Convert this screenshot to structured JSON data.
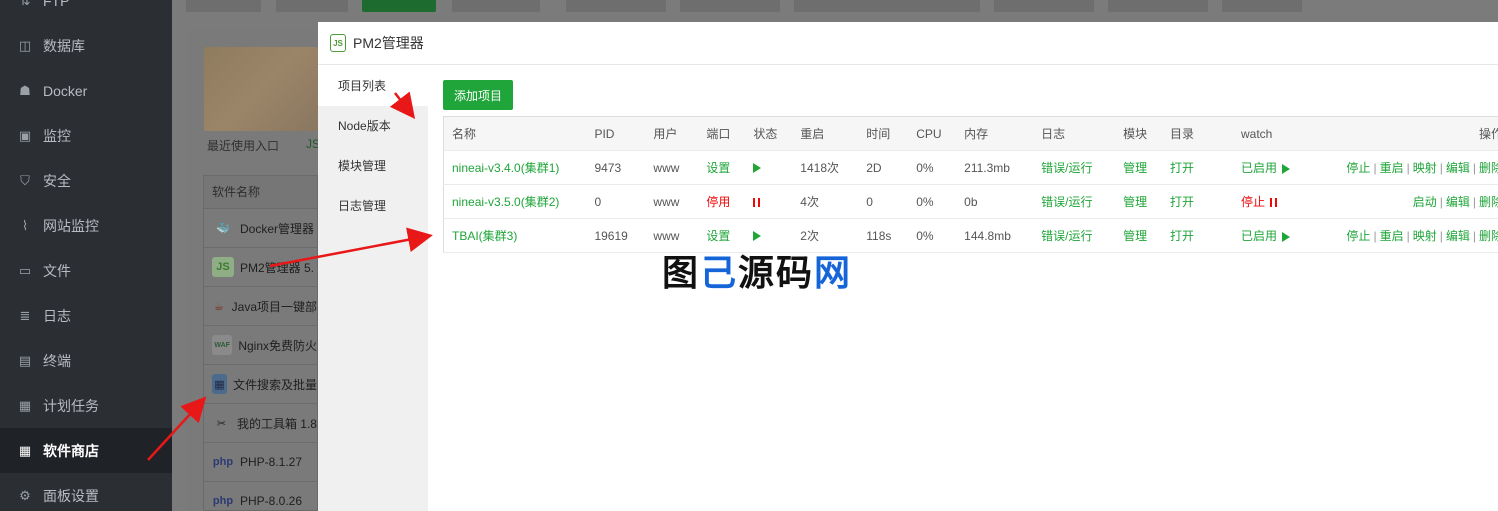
{
  "sidebar": {
    "items": [
      {
        "label": "FTP",
        "icon": "ftp-icon",
        "glyph": "⇅"
      },
      {
        "label": "数据库",
        "icon": "database-icon",
        "glyph": "◫"
      },
      {
        "label": "Docker",
        "icon": "docker-icon",
        "glyph": "☗"
      },
      {
        "label": "监控",
        "icon": "monitor-icon",
        "glyph": "▣"
      },
      {
        "label": "安全",
        "icon": "shield-icon",
        "glyph": "⛉"
      },
      {
        "label": "网站监控",
        "icon": "chart-icon",
        "glyph": "⌇"
      },
      {
        "label": "文件",
        "icon": "folder-icon",
        "glyph": "▭"
      },
      {
        "label": "日志",
        "icon": "log-icon",
        "glyph": "≣"
      },
      {
        "label": "终端",
        "icon": "terminal-icon",
        "glyph": "▤"
      },
      {
        "label": "计划任务",
        "icon": "calendar-icon",
        "glyph": "▦"
      },
      {
        "label": "软件商店",
        "icon": "grid-icon",
        "glyph": "▦",
        "active": true
      },
      {
        "label": "面板设置",
        "icon": "gear-icon",
        "glyph": "⚙"
      }
    ]
  },
  "background": {
    "recent_label": "最近使用入口",
    "table_header": "软件名称",
    "software": [
      {
        "label": "Docker管理器",
        "icon": "docker-icon"
      },
      {
        "label": "PM2管理器 5.",
        "icon": "nodejs-icon"
      },
      {
        "label": "Java项目一键部",
        "icon": "java-icon"
      },
      {
        "label": "Nginx免费防火",
        "icon": "waf-icon"
      },
      {
        "label": "文件搜索及批量",
        "icon": "image-icon"
      },
      {
        "label": "我的工具箱 1.8",
        "icon": "tools-icon"
      },
      {
        "label": "PHP-8.1.27",
        "icon": "php-icon"
      },
      {
        "label": "PHP-8.0.26",
        "icon": "php-icon"
      }
    ]
  },
  "modal": {
    "title": "PM2管理器",
    "nav": [
      "项目列表",
      "Node版本",
      "模块管理",
      "日志管理"
    ],
    "add_button": "添加项目",
    "columns": [
      "名称",
      "PID",
      "用户",
      "端口",
      "状态",
      "重启",
      "时间",
      "CPU",
      "内存",
      "日志",
      "模块",
      "目录",
      "watch",
      "操作"
    ],
    "rows": [
      {
        "name": "nineai-v3.4.0(集群1)",
        "pid": "9473",
        "user": "www",
        "port": "设置",
        "port_style": "g",
        "status": "running",
        "restart": "1418次",
        "time": "2D",
        "cpu": "0%",
        "mem": "211.3mb",
        "log": "错误/运行",
        "module": "管理",
        "dir": "打开",
        "watch": "已启用",
        "watch_on": true,
        "ops": [
          "停止",
          "重启",
          "映射",
          "编辑",
          "删除"
        ]
      },
      {
        "name": "nineai-v3.5.0(集群2)",
        "pid": "0",
        "user": "www",
        "port": "停用",
        "port_style": "r",
        "status": "stopped",
        "restart": "4次",
        "time": "0",
        "cpu": "0%",
        "mem": "0b",
        "log": "错误/运行",
        "module": "管理",
        "dir": "打开",
        "watch": "停止",
        "watch_on": false,
        "ops": [
          "启动",
          "编辑",
          "删除"
        ]
      },
      {
        "name": "TBAI(集群3)",
        "pid": "19619",
        "user": "www",
        "port": "设置",
        "port_style": "g",
        "status": "running",
        "restart": "2次",
        "time": "118s",
        "cpu": "0%",
        "mem": "144.8mb",
        "log": "错误/运行",
        "module": "管理",
        "dir": "打开",
        "watch": "已启用",
        "watch_on": true,
        "ops": [
          "停止",
          "重启",
          "映射",
          "编辑",
          "删除"
        ]
      }
    ]
  },
  "watermark": {
    "part1": "图",
    "part2": "己",
    "part3": "源码",
    "part4": "网"
  },
  "colors": {
    "accent": "#20a53a",
    "danger": "#ef0808",
    "sidebar": "#2b2f34"
  }
}
